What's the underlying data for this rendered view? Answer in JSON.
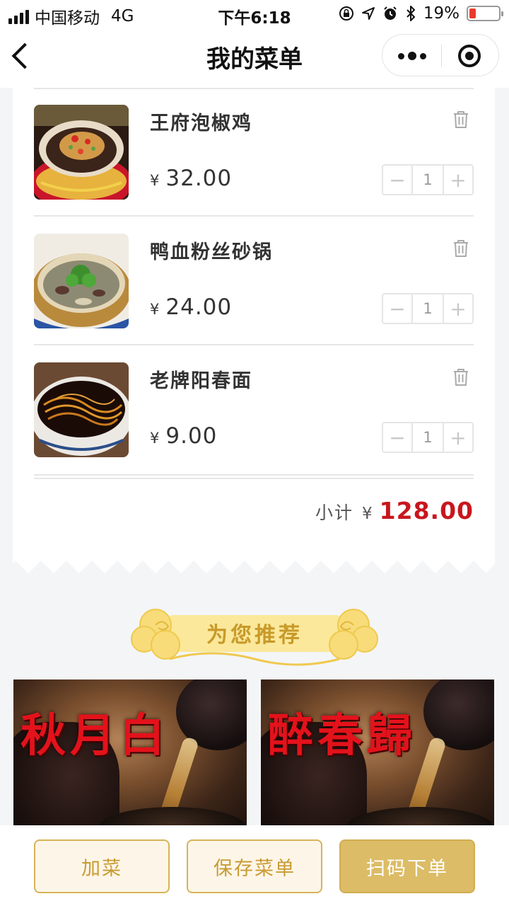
{
  "status_bar": {
    "carrier": "中国移动",
    "network": "4G",
    "time": "下午6:18",
    "battery": "19%",
    "battery_color": "#e83a2d"
  },
  "nav": {
    "title": "我的菜单",
    "back_icon": "chevron-left-icon",
    "more_icon": "more-dots-icon",
    "close_icon": "target-close-icon"
  },
  "menu": {
    "items": [
      {
        "name": "王府泡椒鸡",
        "currency": "¥",
        "price": "32.00",
        "quantity": "1"
      },
      {
        "name": "鸭血粉丝砂锅",
        "currency": "¥",
        "price": "24.00",
        "quantity": "1"
      },
      {
        "name": "老牌阳春面",
        "currency": "¥",
        "price": "9.00",
        "quantity": "1"
      }
    ],
    "subtotal_label": "小计",
    "subtotal_currency": "¥",
    "subtotal_amount": "128.00",
    "subtotal_color": "#c8161d"
  },
  "recommend": {
    "title": "为您推荐",
    "cards": [
      {
        "calligraphy": "秋月白"
      },
      {
        "calligraphy": "醉春歸"
      }
    ]
  },
  "actions": {
    "add_dish": "加菜",
    "save_menu": "保存菜单",
    "scan_order": "扫码下单",
    "accent": "#dcbc66"
  }
}
